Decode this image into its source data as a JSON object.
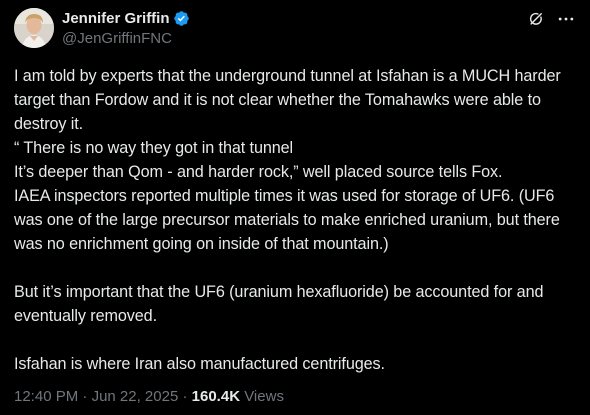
{
  "author": {
    "display_name": "Jennifer Griffin",
    "handle": "@JenGriffinFNC",
    "verified": true,
    "avatar_icon": "profile-photo"
  },
  "actions": {
    "grok_icon": "grok-slash-icon",
    "more_icon": "more-horizontal-icon"
  },
  "tweet": {
    "paragraphs": [
      "I am told by experts that the underground tunnel at Isfahan is a MUCH harder target than Fordow and it is not clear whether the Tomahawks were able to destroy it.\n“ There is no way they got in that tunnel\nIt’s deeper than Qom - and harder rock,” well placed source tells Fox.\n IAEA inspectors reported multiple times it was used for storage of UF6. (UF6 was one of the large precursor materials to make enriched uranium, but there was no enrichment going on inside of that mountain.)",
      "But it’s important that the UF6 (uranium hexafluoride) be accounted for and eventually removed.",
      "Isfahan is where Iran also manufactured centrifuges."
    ]
  },
  "meta": {
    "time": "12:40 PM",
    "separator1": "·",
    "date": "Jun 22, 2025",
    "separator2": "·",
    "views_count": "160.4K",
    "views_label": "Views"
  },
  "colors": {
    "background": "#000000",
    "text_primary": "#e7e9ea",
    "text_secondary": "#71767b",
    "verified_blue": "#1d9bf0"
  }
}
